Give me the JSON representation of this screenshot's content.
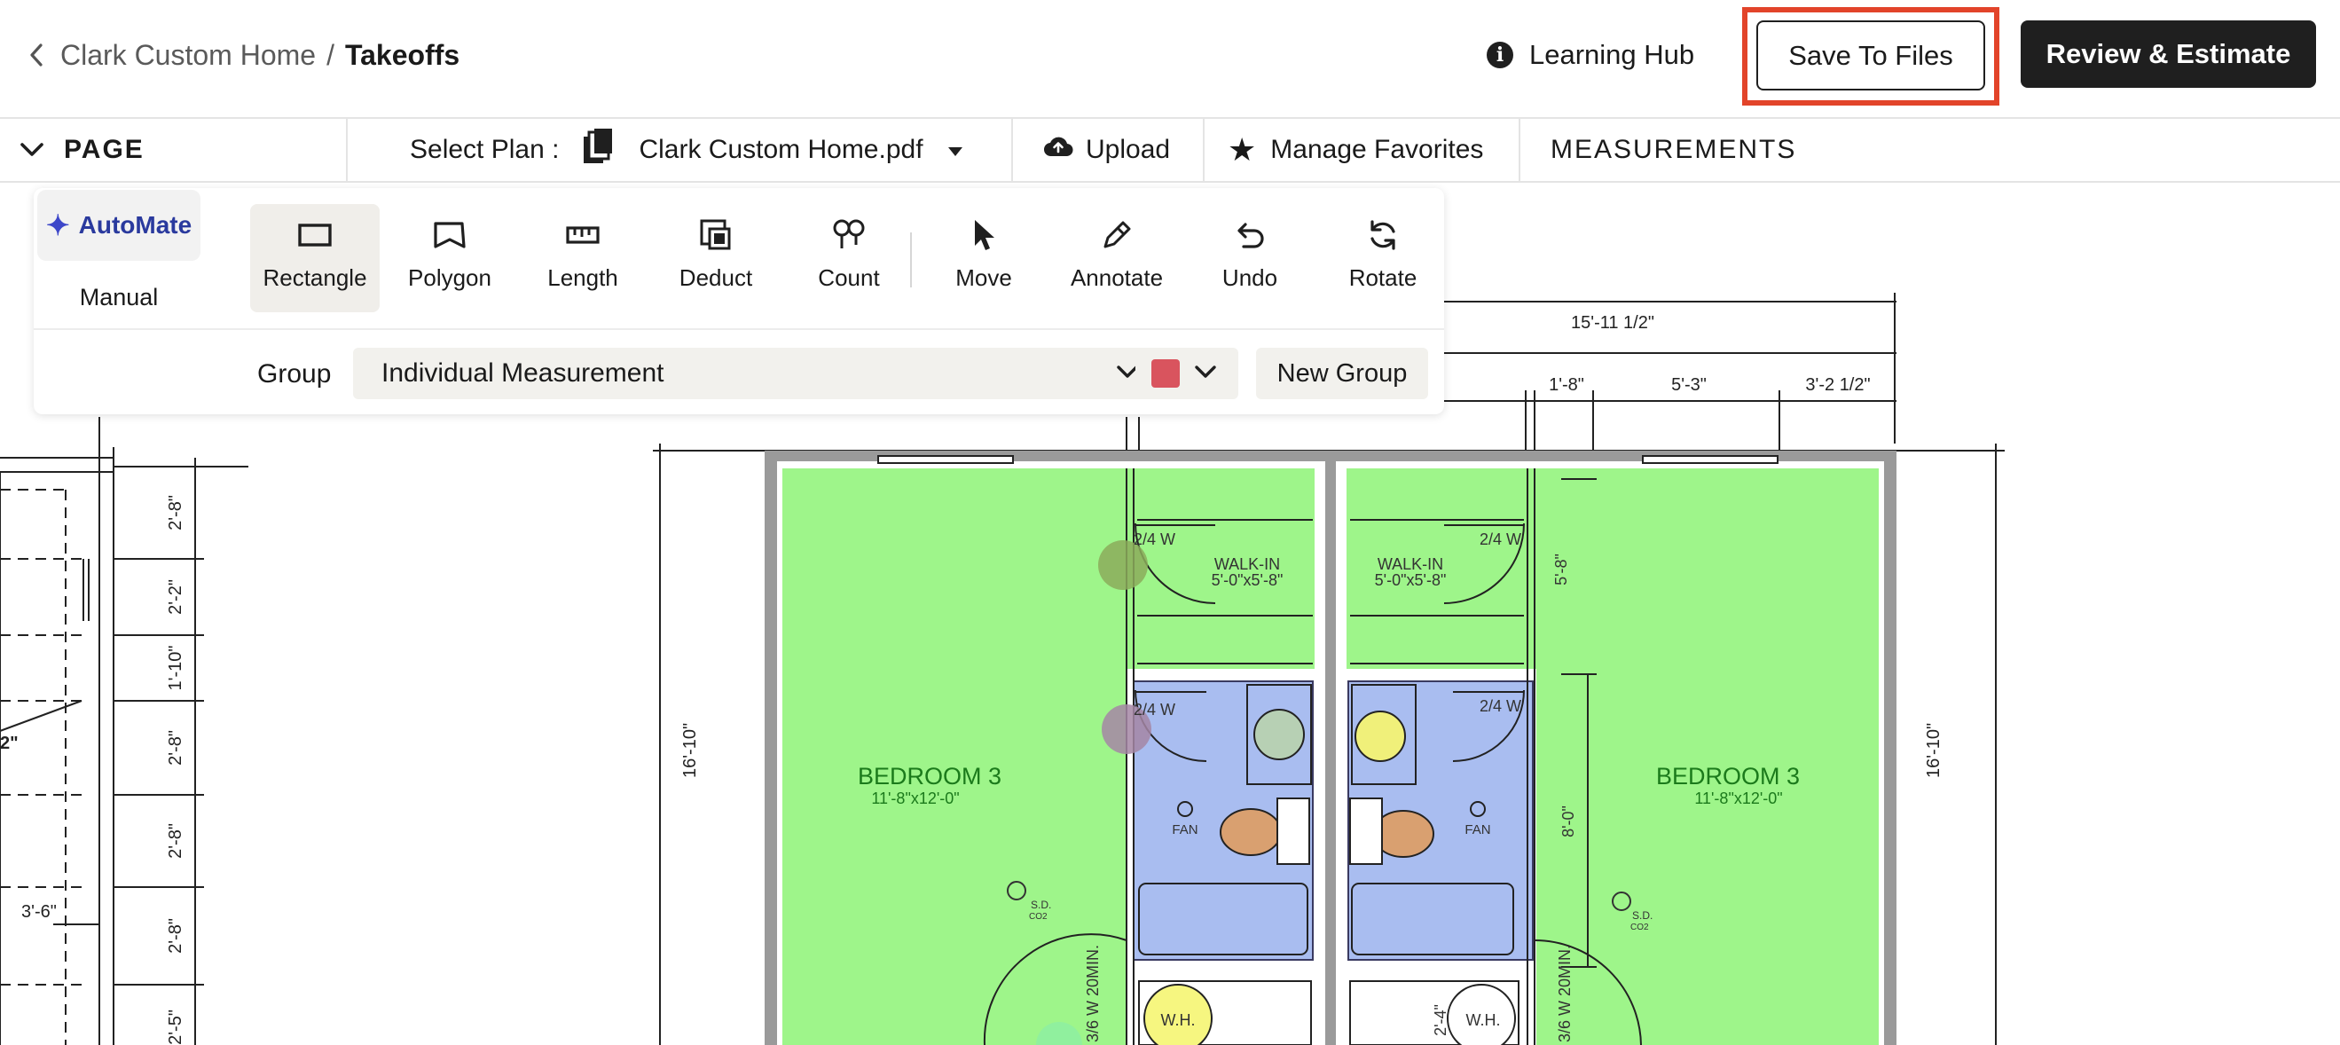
{
  "header": {
    "project": "Clark Custom Home",
    "separator": "/",
    "current": "Takeoffs",
    "learning_hub": "Learning Hub",
    "save_to_files": "Save To Files",
    "review_estimate": "Review & Estimate"
  },
  "subbar": {
    "page": "PAGE",
    "select_plan_label": "Select Plan :",
    "plan_file": "Clark Custom Home.pdf",
    "upload": "Upload",
    "manage_favorites": "Manage Favorites",
    "measurements": "MEASUREMENTS"
  },
  "tools": {
    "automate": "AutoMate",
    "manual": "Manual",
    "items": [
      "Rectangle",
      "Polygon",
      "Length",
      "Deduct",
      "Count",
      "Move",
      "Annotate",
      "Undo",
      "Rotate"
    ],
    "active": "Rectangle",
    "group_label": "Group",
    "group_value": "Individual Measurement",
    "group_color": "#d9545e",
    "new_group": "New Group"
  },
  "plan": {
    "dims_top": [
      "15'-11 1/2\"",
      "1'-8\"",
      "5'-3\"",
      "3'-2 1/2\""
    ],
    "dims_left": [
      "2'-8\"",
      "2'-2\"",
      "1'-10\"",
      "2'-8\"",
      "2'-8\"",
      "2'-8\"",
      "2'-5\""
    ],
    "dim_left_cut": "2\"",
    "dim_side": "3'-6\"",
    "rooms": {
      "bedroom_left_name": "BEDROOM 3",
      "bedroom_left_size": "11'-8\"x12'-0\"",
      "bedroom_right_name": "BEDROOM 3",
      "bedroom_right_size": "11'-8\"x12'-0\"",
      "walkin_left_name": "WALK-IN",
      "walkin_left_size": "5'-0\"x5'-8\"",
      "walkin_right_name": "WALK-IN",
      "walkin_right_size": "5'-0\"x5'-8\"",
      "fan": "FAN",
      "wh": "W.H.",
      "sd": "S.D.",
      "co2": "CO2"
    },
    "door_24w": "2/4 W",
    "dim_16_10": "16'-10\"",
    "dim_5_8": "5'-8\"",
    "dim_8_0": "8'-0\"",
    "dim_2_4": "2'-4\"",
    "door_20min": "3/6 W 20MIN.",
    "colors": {
      "floor_area": "#9ef58a",
      "bath_area": "#a9bdf0",
      "wall": "#9a9a9a"
    }
  }
}
